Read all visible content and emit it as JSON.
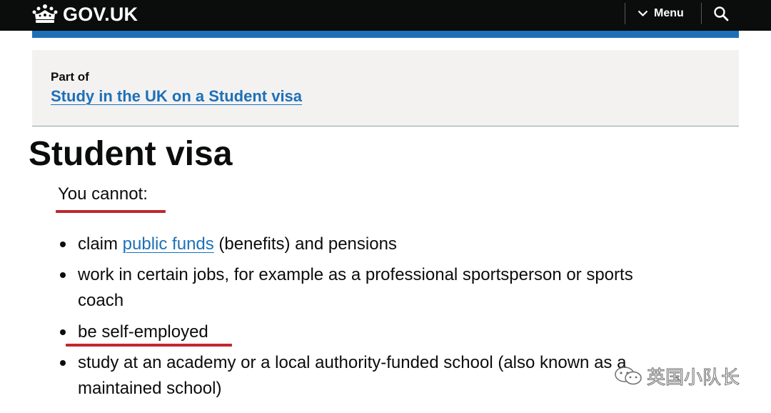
{
  "header": {
    "logo_text": "GOV.UK",
    "menu_label": "Menu",
    "colors": {
      "background": "#0b0c0c",
      "accent_bar": "#1d70b8"
    }
  },
  "part_of": {
    "label": "Part of",
    "link_text": "Study in the UK on a Student visa"
  },
  "page_title": "Student visa",
  "intro": "You cannot:",
  "list": {
    "items": [
      {
        "before": "claim ",
        "link": "public funds",
        "after": " (benefits) and pensions"
      },
      {
        "line1": "work in certain jobs, for example as a professional sportsperson or sports",
        "line2": "coach"
      },
      {
        "text": "be self-employed"
      },
      {
        "line1": "study at an academy or a local authority-funded school (also known as a",
        "line2": "maintained school)"
      }
    ]
  },
  "watermark": {
    "text": "英国小队长"
  },
  "annotation_color": "#c1272d",
  "icons": [
    "crown-icon",
    "chevron-down-icon",
    "search-icon",
    "wechat-icon"
  ]
}
